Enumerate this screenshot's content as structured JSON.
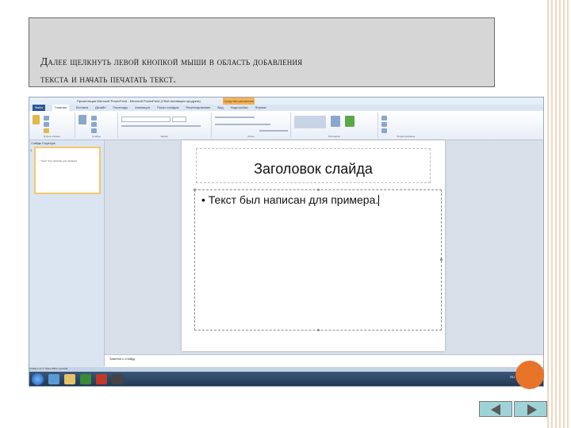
{
  "instruction": {
    "line1": "Далее щелкнуть левой кнопкой мыши в область добавления",
    "line2": "текста и начать печатать текст."
  },
  "ppt": {
    "window_title": "Презентация Microsoft PowerPoint - Microsoft PowerPoint (Сбой активации продукта)",
    "context_tab": "Средства рисования",
    "tabs": [
      "Файл",
      "Главная",
      "Вставка",
      "Дизайн",
      "Переходы",
      "Анимация",
      "Показ слайдов",
      "Рецензирование",
      "Вид",
      "Надстройки",
      "Формат"
    ],
    "ribbon_groups": [
      "Буфер обмена",
      "Слайды",
      "Шрифт",
      "Абзац",
      "Рисование",
      "Редактирование"
    ],
    "thumb_tabs": "Слайды  Структура",
    "thumb_number": "1",
    "thumb_text": "• Текст был написан для примера.",
    "slide": {
      "title": "Заголовок слайда",
      "bullet": "• Текст был написан для примера."
    },
    "notes_placeholder": "Заметки к слайду",
    "status": "Слайд 1 из 1   \"Тема Office\"   русский",
    "tray_lang": "RU",
    "clock_time": "19:09",
    "clock_date": "22.11.2012"
  }
}
